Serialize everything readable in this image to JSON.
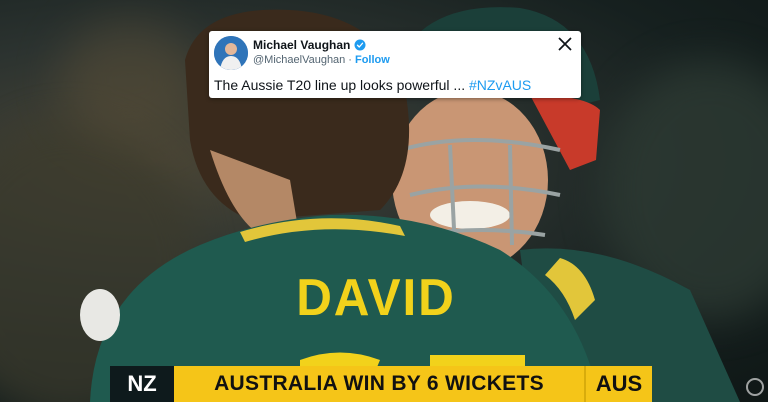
{
  "tweet": {
    "author_name": "Michael Vaughan",
    "author_handle": "@MichaelVaughan",
    "separator": "·",
    "follow_label": "Follow",
    "text": "The Aussie T20 line up looks powerful ... ",
    "hashtag": "#NZvAUS",
    "icons": [
      "verified-badge-icon",
      "x-logo-icon"
    ]
  },
  "jersey": {
    "name": "DAVID"
  },
  "scorebar": {
    "team_left": "NZ",
    "result": "AUSTRALIA WIN BY 6 WICKETS",
    "team_right": "AUS"
  },
  "colors": {
    "jersey_green": "#1f5a4f",
    "jersey_gold": "#f2d21b",
    "scorebar_yellow": "#f5c518",
    "link_blue": "#1d9bf0"
  }
}
